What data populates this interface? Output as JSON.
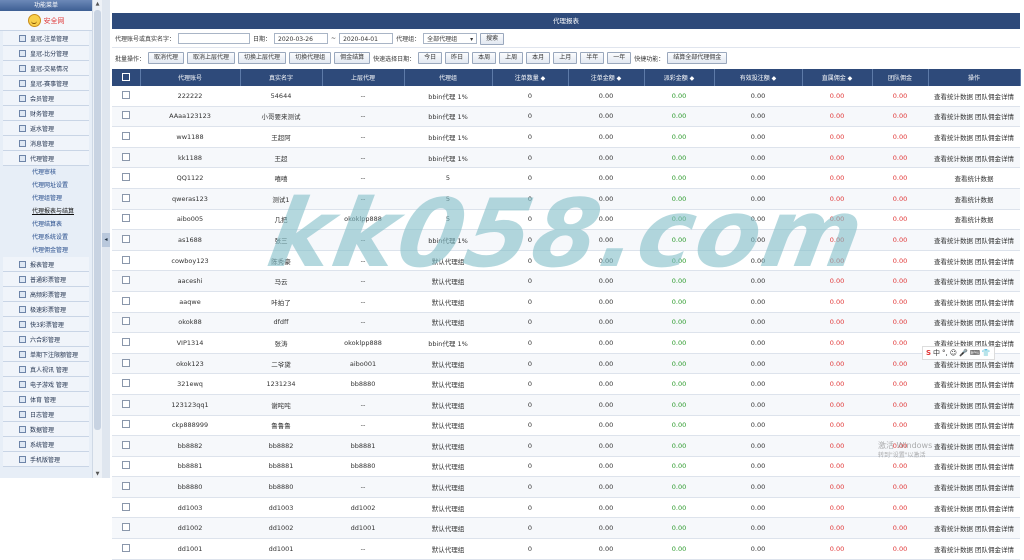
{
  "sidebar": {
    "header": "功能菜单",
    "logo_text": "安全网",
    "menu_before": [
      "皇冠-注单管理",
      "皇冠-比分管理",
      "皇冠-交易情况",
      "皇冠-赛事管理",
      "会员管理",
      "财务管理",
      "返水管理",
      "消息管理",
      "代理管理"
    ],
    "submenu": [
      "代理审核",
      "代理网址设置",
      "代理组管理",
      "代理报表与结算",
      "代理结算表",
      "代理系统设置",
      "代理佣金管理"
    ],
    "active_sub": "代理报表与结算",
    "menu_after": [
      "报表管理",
      "普通彩票管理",
      "高频彩票管理",
      "极速彩票管理",
      "快3彩票管理",
      "六合彩管理",
      "单期下注限额管理",
      "真人视讯 管理",
      "电子游戏 管理",
      "体育 管理",
      "日志管理",
      "数据管理",
      "系统管理",
      "手机版管理"
    ]
  },
  "main": {
    "title": "代理报表",
    "search": {
      "account_label": "代理账号或真实名字：",
      "account_value": "",
      "date_label": "日期：",
      "date_from": "2020-03-26",
      "date_sep": "~",
      "date_to": "2020-04-01",
      "group_label": "代理组：",
      "group_value": "全部代理组",
      "search_button": "搜索"
    },
    "batch": {
      "label": "批量操作：",
      "buttons": [
        "取消代理",
        "取消上层代理",
        "切换上层代理",
        "切换代理组",
        "佣金结算"
      ],
      "quick_date_label": "快速选择日期：",
      "quick_dates": [
        "今日",
        "昨日",
        "本周",
        "上周",
        "本月",
        "上月",
        "半年",
        "一年"
      ],
      "quick_func_label": "快捷功能：",
      "settle_all": "结算全部代理佣金"
    },
    "table": {
      "headers": [
        "",
        "代理账号",
        "真实名字",
        "上层代理",
        "代理组",
        "注单数量 ◆",
        "注单金额 ◆",
        "派彩金额 ◆",
        "有效投注额 ◆",
        "直属佣金 ◆",
        "团队佣金",
        "操作"
      ],
      "rows": [
        [
          "222222",
          "54644",
          "--",
          "bbin代理 1%",
          "0",
          "0.00",
          "0.00",
          "0.00",
          "0.00",
          "0.00",
          "查看统计数据 团队佣金详情"
        ],
        [
          "AAaa123123",
          "小哥要来测试",
          "--",
          "bbin代理 1%",
          "0",
          "0.00",
          "0.00",
          "0.00",
          "0.00",
          "0.00",
          "查看统计数据 团队佣金详情"
        ],
        [
          "ww1188",
          "王超阿",
          "--",
          "bbin代理 1%",
          "0",
          "0.00",
          "0.00",
          "0.00",
          "0.00",
          "0.00",
          "查看统计数据 团队佣金详情"
        ],
        [
          "kk1188",
          "王超",
          "--",
          "bbin代理 1%",
          "0",
          "0.00",
          "0.00",
          "0.00",
          "0.00",
          "0.00",
          "查看统计数据 团队佣金详情"
        ],
        [
          "QQ1122",
          "嘻嘻",
          "--",
          "5",
          "0",
          "0.00",
          "0.00",
          "0.00",
          "0.00",
          "0.00",
          "查看统计数据"
        ],
        [
          "qweras123",
          "测试1",
          "--",
          "5",
          "0",
          "0.00",
          "0.00",
          "0.00",
          "0.00",
          "0.00",
          "查看统计数据"
        ],
        [
          "aibo005",
          "几把",
          "okoklpp888",
          "5",
          "0",
          "0.00",
          "0.00",
          "0.00",
          "0.00",
          "0.00",
          "查看统计数据"
        ],
        [
          "as1688",
          "张三",
          "--",
          "bbin代理 1%",
          "0",
          "0.00",
          "0.00",
          "0.00",
          "0.00",
          "0.00",
          "查看统计数据 团队佣金详情"
        ],
        [
          "cowboy123",
          "陈秀豪",
          "--",
          "默认代理组",
          "0",
          "0.00",
          "0.00",
          "0.00",
          "0.00",
          "0.00",
          "查看统计数据 团队佣金详情"
        ],
        [
          "aaceshi",
          "马云",
          "--",
          "默认代理组",
          "0",
          "0.00",
          "0.00",
          "0.00",
          "0.00",
          "0.00",
          "查看统计数据 团队佣金详情"
        ],
        [
          "aaqwe",
          "咔拍了",
          "--",
          "默认代理组",
          "0",
          "0.00",
          "0.00",
          "0.00",
          "0.00",
          "0.00",
          "查看统计数据 团队佣金详情"
        ],
        [
          "okok88",
          "dfdff",
          "--",
          "默认代理组",
          "0",
          "0.00",
          "0.00",
          "0.00",
          "0.00",
          "0.00",
          "查看统计数据 团队佣金详情"
        ],
        [
          "VIP1314",
          "张涛",
          "okoklpp888",
          "bbin代理 1%",
          "0",
          "0.00",
          "0.00",
          "0.00",
          "0.00",
          "0.00",
          "查看统计数据 团队佣金详情"
        ],
        [
          "okok123",
          "二爷黛",
          "aibo001",
          "默认代理组",
          "0",
          "0.00",
          "0.00",
          "0.00",
          "0.00",
          "0.00",
          "查看统计数据 团队佣金详情"
        ],
        [
          "321ewq",
          "1231234",
          "bb8880",
          "默认代理组",
          "0",
          "0.00",
          "0.00",
          "0.00",
          "0.00",
          "0.00",
          "查看统计数据 团队佣金详情"
        ],
        [
          "123123qq1",
          "谢咤咤",
          "--",
          "默认代理组",
          "0",
          "0.00",
          "0.00",
          "0.00",
          "0.00",
          "0.00",
          "查看统计数据 团队佣金详情"
        ],
        [
          "ckp888999",
          "鲁鲁鲁",
          "--",
          "默认代理组",
          "0",
          "0.00",
          "0.00",
          "0.00",
          "0.00",
          "0.00",
          "查看统计数据 团队佣金详情"
        ],
        [
          "bb8882",
          "bb8882",
          "bb8881",
          "默认代理组",
          "0",
          "0.00",
          "0.00",
          "0.00",
          "0.00",
          "0.00",
          "查看统计数据 团队佣金详情"
        ],
        [
          "bb8881",
          "bb8881",
          "bb8880",
          "默认代理组",
          "0",
          "0.00",
          "0.00",
          "0.00",
          "0.00",
          "0.00",
          "查看统计数据 团队佣金详情"
        ],
        [
          "bb8880",
          "bb8880",
          "--",
          "默认代理组",
          "0",
          "0.00",
          "0.00",
          "0.00",
          "0.00",
          "0.00",
          "查看统计数据 团队佣金详情"
        ],
        [
          "dd1003",
          "dd1003",
          "dd1002",
          "默认代理组",
          "0",
          "0.00",
          "0.00",
          "0.00",
          "0.00",
          "0.00",
          "查看统计数据 团队佣金详情"
        ],
        [
          "dd1002",
          "dd1002",
          "dd1001",
          "默认代理组",
          "0",
          "0.00",
          "0.00",
          "0.00",
          "0.00",
          "0.00",
          "查看统计数据 团队佣金详情"
        ],
        [
          "dd1001",
          "dd1001",
          "--",
          "默认代理组",
          "0",
          "0.00",
          "0.00",
          "0.00",
          "0.00",
          "0.00",
          "查看统计数据 团队佣金详情"
        ]
      ]
    }
  },
  "overlays": {
    "watermark": "kk058.com",
    "ime": [
      "S",
      "中",
      "°,",
      "☺",
      "🎤",
      "⌨",
      "👕"
    ],
    "windows_line1": "激活 Windows",
    "windows_line2": "转到\"设置\"以激活"
  }
}
